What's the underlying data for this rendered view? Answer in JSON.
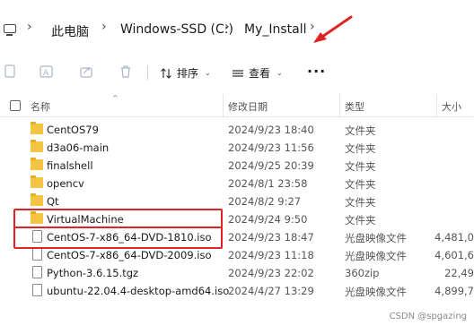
{
  "address_bar": {
    "crumbs": [
      "此电脑",
      "Windows-SSD (C:)",
      "My_Install"
    ]
  },
  "toolbar": {
    "sort_label": "排序",
    "view_label": "查看",
    "more_label": "···"
  },
  "columns": {
    "name": "名称",
    "date": "修改日期",
    "type": "类型",
    "size": "大小"
  },
  "files": [
    {
      "name": "CentOS79",
      "date": "2024/9/23 18:40",
      "type": "文件夹",
      "size": "",
      "kind": "folder"
    },
    {
      "name": "d3a06-main",
      "date": "2024/9/23 11:56",
      "type": "文件夹",
      "size": "",
      "kind": "folder"
    },
    {
      "name": "finalshell",
      "date": "2024/9/25 20:39",
      "type": "文件夹",
      "size": "",
      "kind": "folder"
    },
    {
      "name": "opencv",
      "date": "2024/8/1 23:58",
      "type": "文件夹",
      "size": "",
      "kind": "folder"
    },
    {
      "name": "Qt",
      "date": "2024/8/2 9:27",
      "type": "文件夹",
      "size": "",
      "kind": "folder"
    },
    {
      "name": "VirtualMachine",
      "date": "2024/9/24 9:50",
      "type": "文件夹",
      "size": "",
      "kind": "folder"
    },
    {
      "name": "CentOS-7-x86_64-DVD-1810.iso",
      "date": "2024/9/23 18:47",
      "type": "光盘映像文件",
      "size": "4,481,0",
      "kind": "file"
    },
    {
      "name": "CentOS-7-x86_64-DVD-2009.iso",
      "date": "2024/9/23 11:18",
      "type": "光盘映像文件",
      "size": "4,601,6",
      "kind": "file"
    },
    {
      "name": "Python-3.6.15.tgz",
      "date": "2024/9/23 22:02",
      "type": "360zip",
      "size": "22,49",
      "kind": "file"
    },
    {
      "name": "ubuntu-22.04.4-desktop-amd64.iso",
      "date": "2024/4/27 13:29",
      "type": "光盘映像文件",
      "size": "4,899,7",
      "kind": "file"
    }
  ],
  "watermark": "CSDN @spgazing",
  "colors": {
    "annotation_red": "#e02424",
    "folder_yellow": "#f4c542"
  }
}
